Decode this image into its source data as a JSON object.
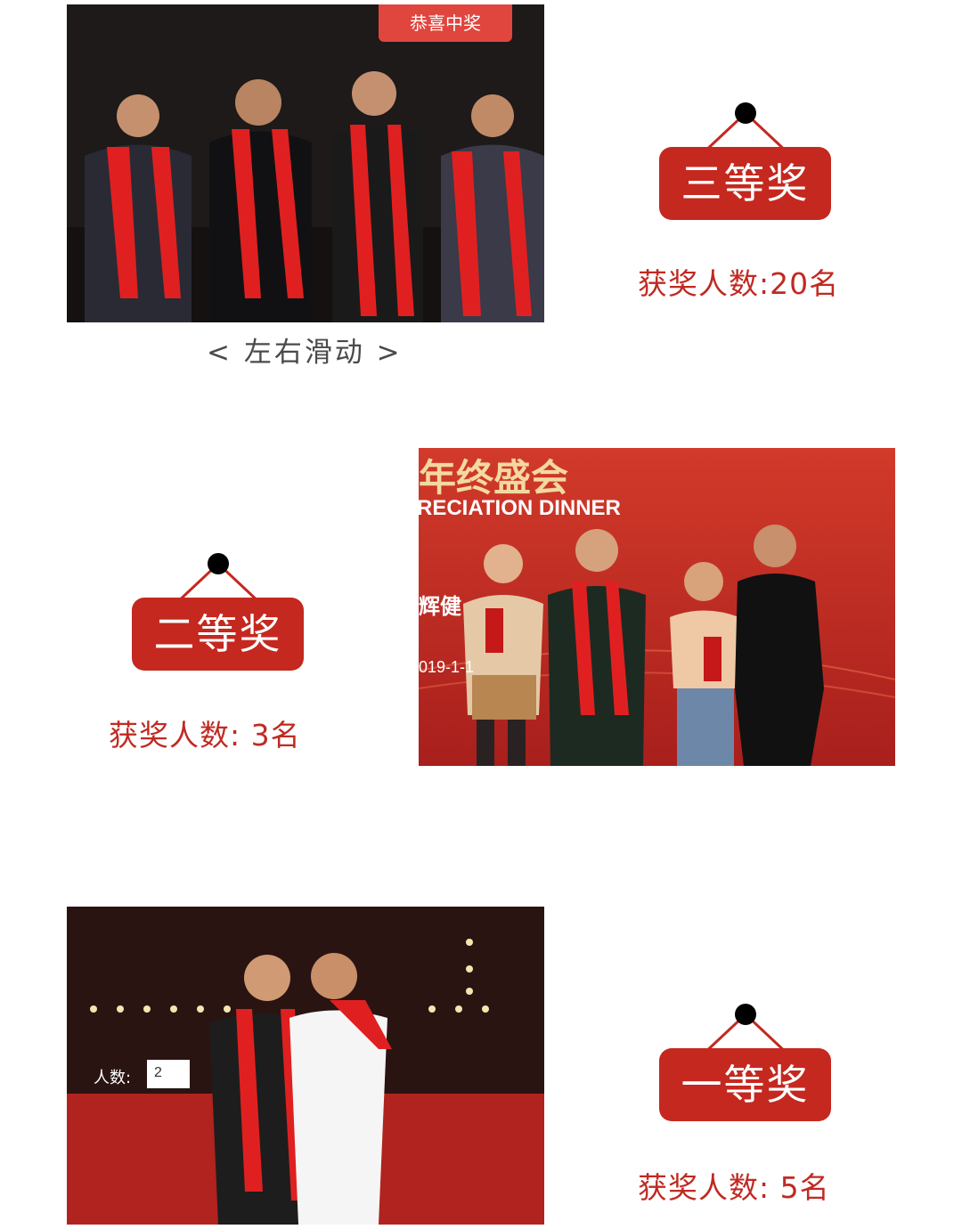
{
  "photo_1": {
    "overlay_button": "恭喜中奖"
  },
  "swipe_hint": "< 左右滑动 >",
  "photo_2": {
    "banner_line1": "年终盛会",
    "banner_line2": "RECIATION DINNER",
    "banner_side": "辉健",
    "date_fragment": "019-1-1"
  },
  "photo_3": {
    "people_label": "人数:",
    "people_value": "2"
  },
  "prizes": [
    {
      "title": "三等奖",
      "count_text": "获奖人数:20名"
    },
    {
      "title": "二等奖",
      "count_text": "获奖人数: 3名"
    },
    {
      "title": "一等奖",
      "count_text": "获奖人数: 5名"
    }
  ],
  "colors": {
    "plaque_red": "#c5281f",
    "count_red": "#c02a22",
    "scarf_red": "#e02020"
  }
}
